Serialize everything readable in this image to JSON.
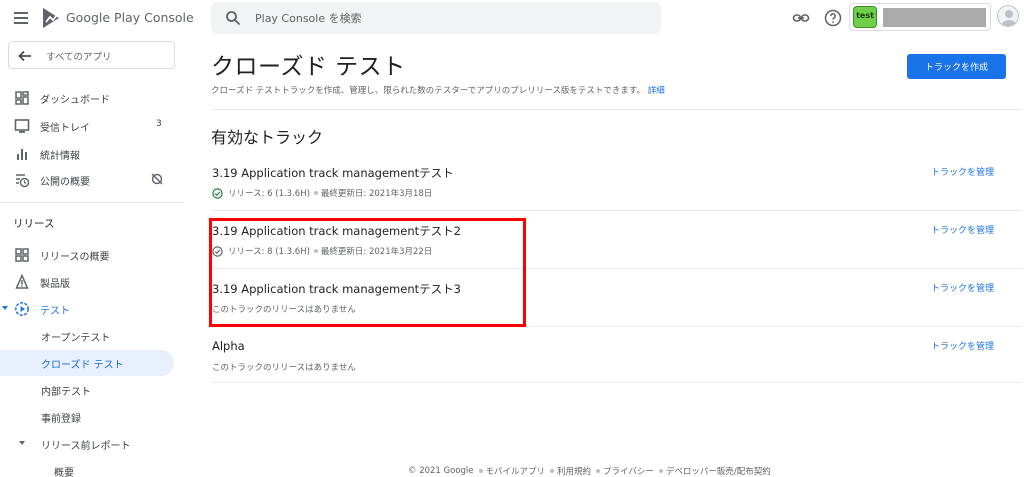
{
  "header": {
    "brand": "Google Play Console",
    "search_placeholder": "Play Console を検索",
    "account_avatar_text": "test"
  },
  "sidebar": {
    "all_apps": "すべてのアプリ",
    "items": [
      {
        "label": "ダッシュボード"
      },
      {
        "label": "受信トレイ",
        "count": "3"
      },
      {
        "label": "統計情報"
      },
      {
        "label": "公開の概要"
      }
    ],
    "release_section": "リリース",
    "release_items": [
      {
        "label": "リリースの概要"
      },
      {
        "label": "製品版"
      },
      {
        "label": "テスト"
      }
    ],
    "test_sub": [
      {
        "label": "オープンテスト"
      },
      {
        "label": "クローズド テスト"
      },
      {
        "label": "内部テスト"
      },
      {
        "label": "事前登録"
      }
    ],
    "prelaunch": "リリース前レポート",
    "prelaunch_sub": [
      {
        "label": "概要"
      }
    ]
  },
  "main": {
    "title": "クローズド テスト",
    "description": "クローズド テストトラックを作成、管理し、限られた数のテスターでアプリのプレリリース版をテストできます。",
    "description_link": "詳細",
    "create_button": "トラックを作成",
    "section_heading": "有効なトラック",
    "manage_label": "トラックを管理",
    "tracks": [
      {
        "name": "3.19 Application track managementテスト",
        "release": "リリース: 6 (1.3.6H)",
        "updated": "最終更新日: 2021年3月18日"
      },
      {
        "name": "3.19 Application track managementテスト2",
        "release": "リリース: 8 (1.3.6H)",
        "updated": "最終更新日: 2021年3月22日"
      },
      {
        "name": "3.19 Application track managementテスト3",
        "no_release": "このトラックのリリースはありません"
      },
      {
        "name": "Alpha",
        "no_release": "このトラックのリリースはありません"
      }
    ]
  },
  "footer": {
    "copyright": "© 2021 Google",
    "links": [
      "モバイルアプリ",
      "利用規約",
      "プライバシー",
      "デベロッパー販売/配布契約"
    ]
  },
  "colors": {
    "accent": "#1a73e8",
    "highlight": "#ff0000",
    "selected_bg": "#e8f0fe"
  }
}
